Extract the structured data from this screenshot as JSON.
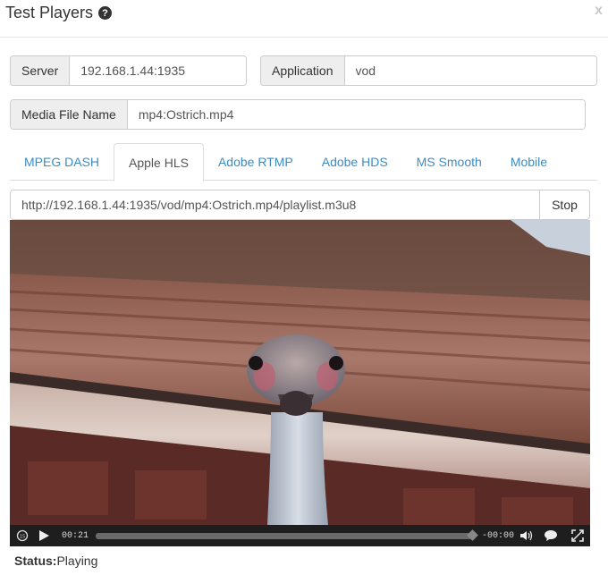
{
  "header": {
    "title": "Test Players",
    "help_icon": "question-circle-icon",
    "close_label": "x"
  },
  "server": {
    "label": "Server",
    "value": "192.168.1.44:1935"
  },
  "application": {
    "label": "Application",
    "value": "vod"
  },
  "media_file": {
    "label": "Media File Name",
    "value": "mp4:Ostrich.mp4"
  },
  "tabs": [
    {
      "label": "MPEG DASH",
      "active": false
    },
    {
      "label": "Apple HLS",
      "active": true
    },
    {
      "label": "Adobe RTMP",
      "active": false
    },
    {
      "label": "Adobe HDS",
      "active": false
    },
    {
      "label": "MS Smooth",
      "active": false
    },
    {
      "label": "Mobile",
      "active": false
    }
  ],
  "stream": {
    "url": "http://192.168.1.44:1935/vod/mp4:Ostrich.mp4/playlist.m3u8",
    "stop_label": "Stop"
  },
  "player": {
    "elapsed": "00:21",
    "remaining": "-00:00",
    "progress_fraction": 1.0
  },
  "status": {
    "label": "Status:",
    "value": "Playing"
  },
  "colors": {
    "link": "#3a8cc4",
    "addon_bg": "#eeeeee",
    "controls_bg": "#1e1e1e"
  }
}
